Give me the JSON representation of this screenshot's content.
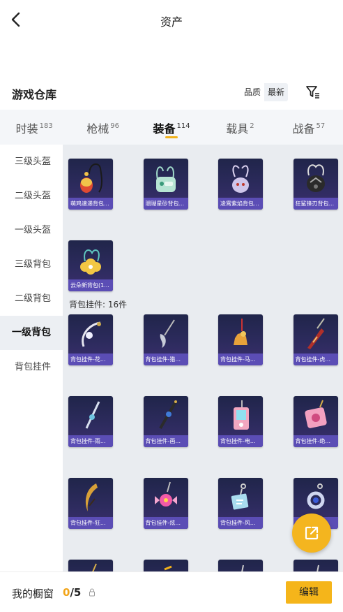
{
  "header": {
    "title": "资产"
  },
  "warehouse": {
    "title": "游戏仓库",
    "sort_options": [
      "品质",
      "最新"
    ]
  },
  "categories": [
    {
      "label": "时装",
      "count": "183"
    },
    {
      "label": "枪械",
      "count": "96"
    },
    {
      "label": "装备",
      "count": "114"
    },
    {
      "label": "载具",
      "count": "2"
    },
    {
      "label": "战备",
      "count": "57"
    }
  ],
  "sidebar": {
    "items": [
      "三级头盔",
      "二级头盔",
      "一级头盔",
      "三级背包",
      "二级背包",
      "一级背包",
      "背包挂件"
    ],
    "active": "一级背包"
  },
  "backpacks": [
    "萌鸡速递背包...",
    "珊瑚星砂背包...",
    "凌霄紫焰背包...",
    "狂鲨锋刃背包...",
    "云朵新背包(1..."
  ],
  "charm_section_label": "背包挂件: 16件",
  "charms": [
    "背包挂件-花...",
    "背包挂件-猎...",
    "背包挂件-马...",
    "背包挂件-虎...",
    "背包挂件-雨...",
    "背包挂件-画...",
    "背包挂件-电...",
    "背包挂件-绝...",
    "背包挂件-狂...",
    "背包挂件-炫...",
    "背包挂件-风..."
  ],
  "bottom": {
    "window_label": "我的橱窗",
    "window_current": "0",
    "window_total": "/5",
    "edit_label": "编辑"
  },
  "colors": {
    "accent": "#f5b51a",
    "item_label_bg": "#5b4db5",
    "item_bg": "#2d2b5e"
  }
}
